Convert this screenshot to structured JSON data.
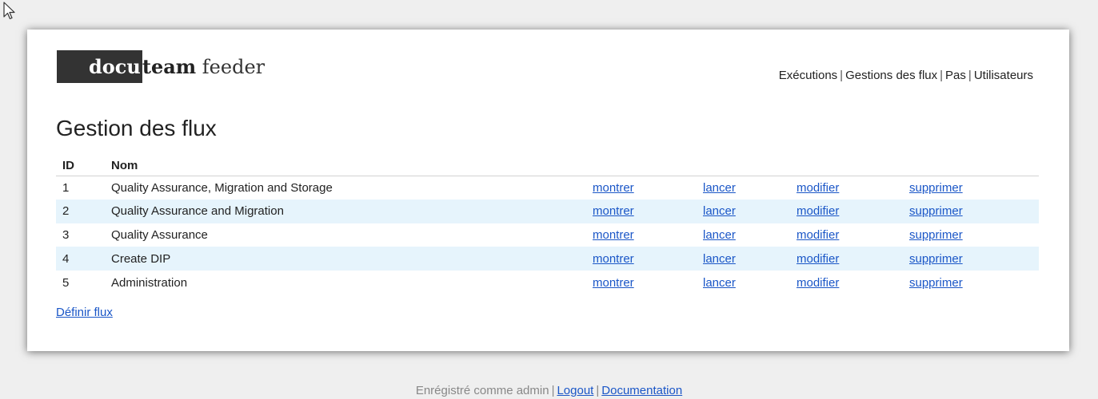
{
  "brand": {
    "logo_part1": "docu",
    "logo_part2": "team",
    "logo_part3": " feeder"
  },
  "nav": {
    "items": [
      {
        "label": "Exécutions"
      },
      {
        "label": "Gestions des flux"
      },
      {
        "label": "Pas"
      },
      {
        "label": "Utilisateurs"
      }
    ],
    "separator": "|"
  },
  "page": {
    "title": "Gestion des flux"
  },
  "table": {
    "headers": {
      "id": "ID",
      "nom": "Nom"
    },
    "rows": [
      {
        "id": "1",
        "nom": "Quality Assurance, Migration and Storage",
        "a1": "montrer",
        "a2": "lancer",
        "a3": "modifier",
        "a4": "supprimer"
      },
      {
        "id": "2",
        "nom": "Quality Assurance and Migration",
        "a1": "montrer",
        "a2": "lancer",
        "a3": "modifier",
        "a4": "supprimer"
      },
      {
        "id": "3",
        "nom": "Quality Assurance",
        "a1": "montrer",
        "a2": "lancer",
        "a3": "modifier",
        "a4": "supprimer"
      },
      {
        "id": "4",
        "nom": "Create DIP",
        "a1": "montrer",
        "a2": "lancer",
        "a3": "modifier",
        "a4": "supprimer"
      },
      {
        "id": "5",
        "nom": "Administration",
        "a1": "montrer",
        "a2": "lancer",
        "a3": "modifier",
        "a4": "supprimer"
      }
    ]
  },
  "actions": {
    "define_flux": "Définir flux"
  },
  "footer": {
    "logged_in_text": "Enrégistré comme admin",
    "separator": "|",
    "logout": "Logout",
    "documentation": "Documentation"
  },
  "colors": {
    "link": "#1a56c7",
    "row_alt": "#e6f4fc",
    "logo_block": "#333333",
    "page_bg": "#efefef"
  }
}
